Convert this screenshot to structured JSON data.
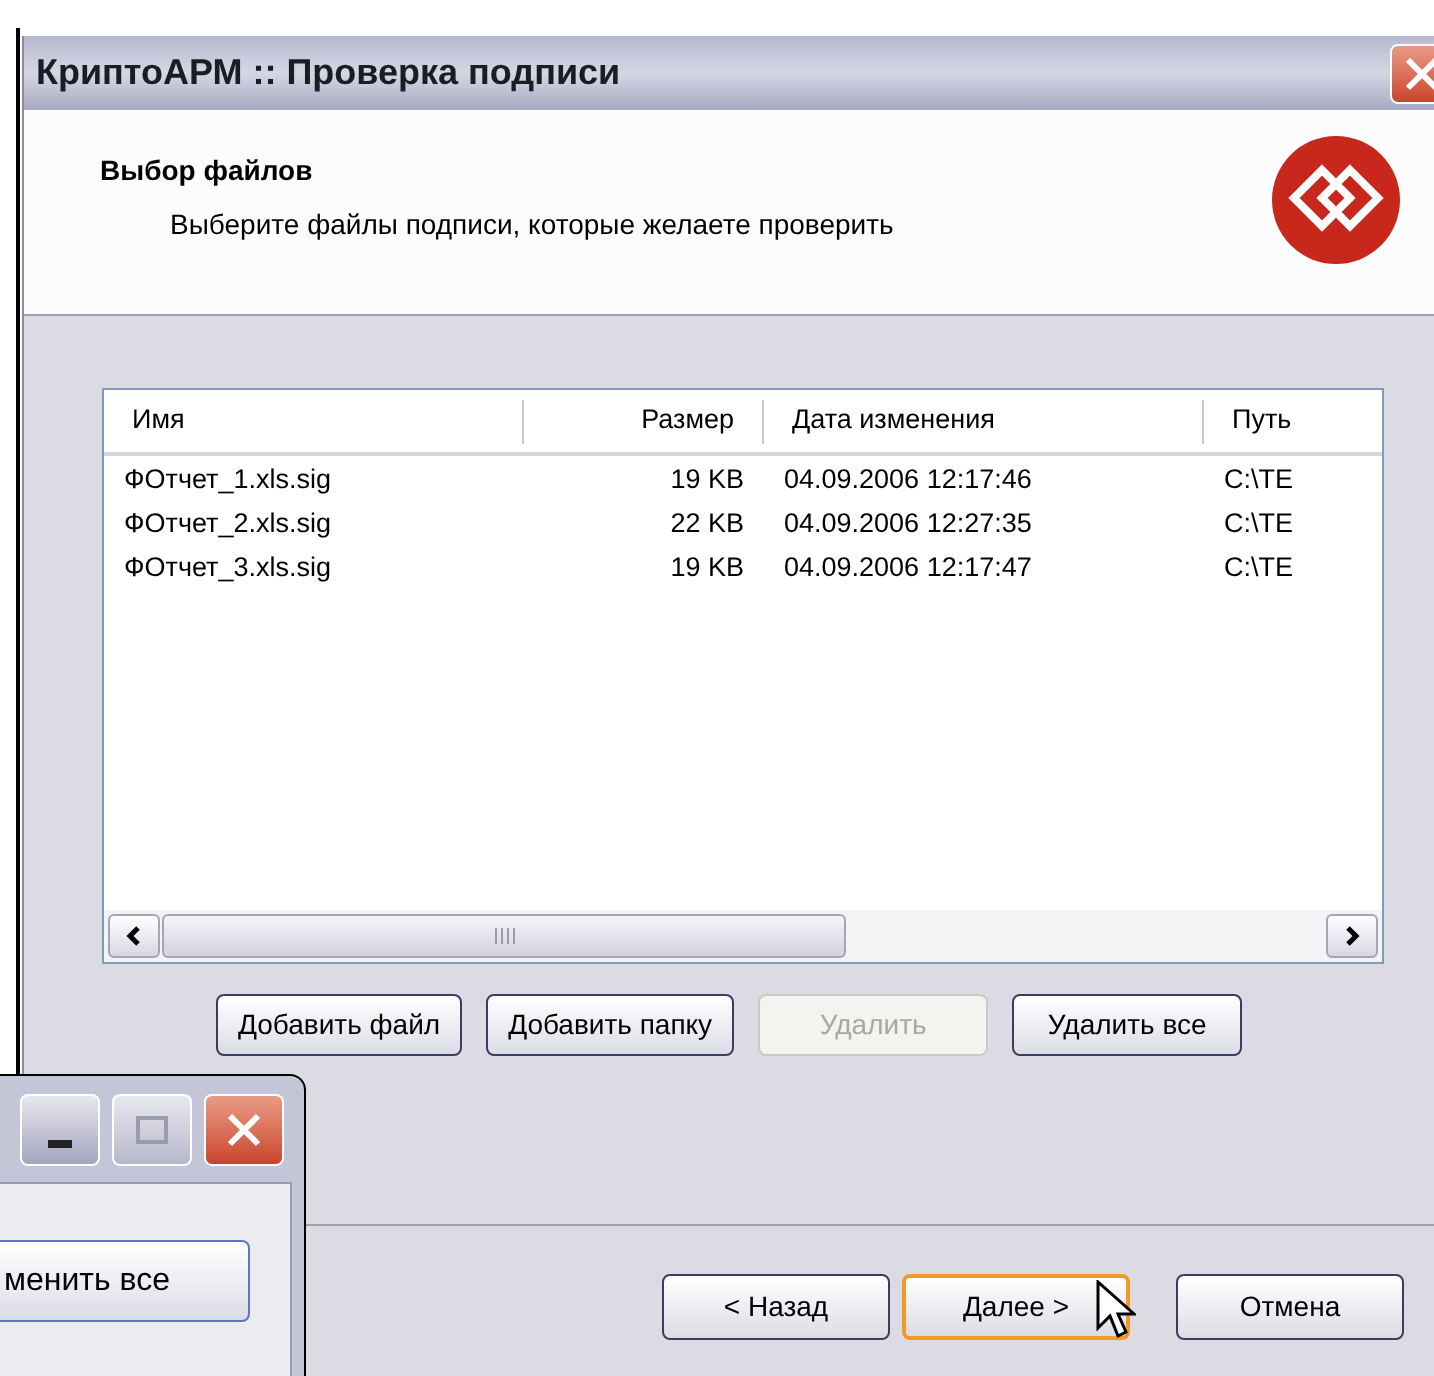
{
  "window": {
    "title": "КриптоАРМ :: Проверка подписи"
  },
  "header": {
    "title": "Выбор файлов",
    "subtitle": "Выберите файлы подписи, которые желаете проверить"
  },
  "table": {
    "columns": [
      "Имя",
      "Размер",
      "Дата изменения",
      "Путь"
    ],
    "rows": [
      [
        "ФОтчет_1.xls.sig",
        "19 KB",
        "04.09.2006 12:17:46",
        "C:\\TE"
      ],
      [
        "ФОтчет_2.xls.sig",
        "22 KB",
        "04.09.2006 12:27:35",
        "C:\\TE"
      ],
      [
        "ФОтчет_3.xls.sig",
        "19 KB",
        "04.09.2006 12:17:47",
        "C:\\TE"
      ]
    ]
  },
  "file_buttons": [
    {
      "label": "Добавить файл",
      "disabled": false
    },
    {
      "label": "Добавить папку",
      "disabled": false
    },
    {
      "label": "Удалить",
      "disabled": true
    },
    {
      "label": "Удалить все",
      "disabled": false
    }
  ],
  "nav_buttons": [
    {
      "label": "< Назад",
      "selected": false
    },
    {
      "label": "Далее >",
      "selected": true
    },
    {
      "label": "Отмена",
      "selected": false
    }
  ],
  "background_window": {
    "button": "менить все"
  }
}
